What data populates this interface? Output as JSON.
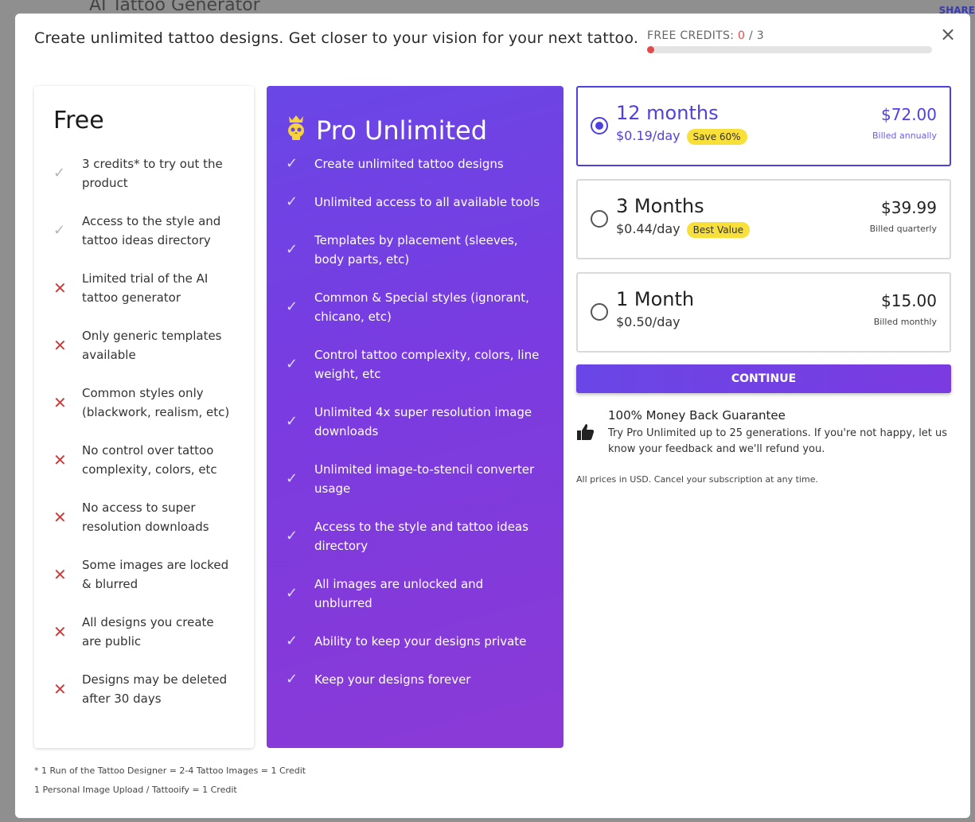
{
  "background": {
    "title": "AI Tattoo Generator",
    "share": "SHARE"
  },
  "header": {
    "text": "Create unlimited tattoo designs. Get closer to your vision for your next tattoo.",
    "credits_label": "FREE CREDITS:",
    "credits_used": "0",
    "credits_total": "/ 3",
    "credits_progress": 0,
    "close_label": "×"
  },
  "free": {
    "title": "Free",
    "features": [
      {
        "icon": "check-icon",
        "text": "3 credits* to try out the product",
        "ok": true
      },
      {
        "icon": "check-icon",
        "text": "Access to the style and tattoo ideas directory",
        "ok": true
      },
      {
        "icon": "x-icon",
        "text": "Limited trial of the AI tattoo generator",
        "ok": false
      },
      {
        "icon": "x-icon",
        "text": "Only generic templates available",
        "ok": false
      },
      {
        "icon": "x-icon",
        "text": "Common styles only (blackwork, realism, etc)",
        "ok": false
      },
      {
        "icon": "x-icon",
        "text": "No control over tattoo complexity, colors, etc",
        "ok": false
      },
      {
        "icon": "x-icon",
        "text": "No access to super resolution downloads",
        "ok": false
      },
      {
        "icon": "x-icon",
        "text": "Some images are locked & blurred",
        "ok": false
      },
      {
        "icon": "x-icon",
        "text": "All designs you create are public",
        "ok": false
      },
      {
        "icon": "x-icon",
        "text": "Designs may be deleted after 30 days",
        "ok": false
      }
    ]
  },
  "pro": {
    "title": "Pro Unlimited",
    "icon": "crown-skull-icon",
    "features": [
      "Create unlimited tattoo designs",
      "Unlimited access to all available tools",
      "Templates by placement (sleeves, body parts, etc)",
      "Common & Special styles (ignorant, chicano, etc)",
      "Control tattoo complexity, colors, line weight, etc",
      "Unlimited 4x super resolution image downloads",
      "Unlimited image-to-stencil converter usage",
      "Access to the style and tattoo ideas directory",
      "All images are unlocked and unblurred",
      "Ability to keep your designs private",
      "Keep your designs forever"
    ]
  },
  "plans": [
    {
      "name": "12 months",
      "per_day": "$0.19/day",
      "badge": "Save 60%",
      "price": "$72.00",
      "billed": "Billed annually",
      "selected": true
    },
    {
      "name": "3 Months",
      "per_day": "$0.44/day",
      "badge": "Best Value",
      "price": "$39.99",
      "billed": "Billed quarterly",
      "selected": false
    },
    {
      "name": "1 Month",
      "per_day": "$0.50/day",
      "badge": "",
      "price": "$15.00",
      "billed": "Billed monthly",
      "selected": false
    }
  ],
  "continue_label": "CONTINUE",
  "guarantee": {
    "title": "100% Money Back Guarantee",
    "desc": "Try Pro Unlimited up to 25 generations. If you're not happy, let us know your feedback and we'll refund you."
  },
  "prices_note": "All prices in USD. Cancel your subscription at any time.",
  "footnotes": [
    "* 1 Run of the Tattoo Designer = 2-4 Tattoo Images = 1 Credit",
    "1 Personal Image Upload / Tattooify = 1 Credit"
  ],
  "colors": {
    "accent": "#5040e0",
    "badge": "#f8df3a",
    "error": "#d23a3a"
  }
}
